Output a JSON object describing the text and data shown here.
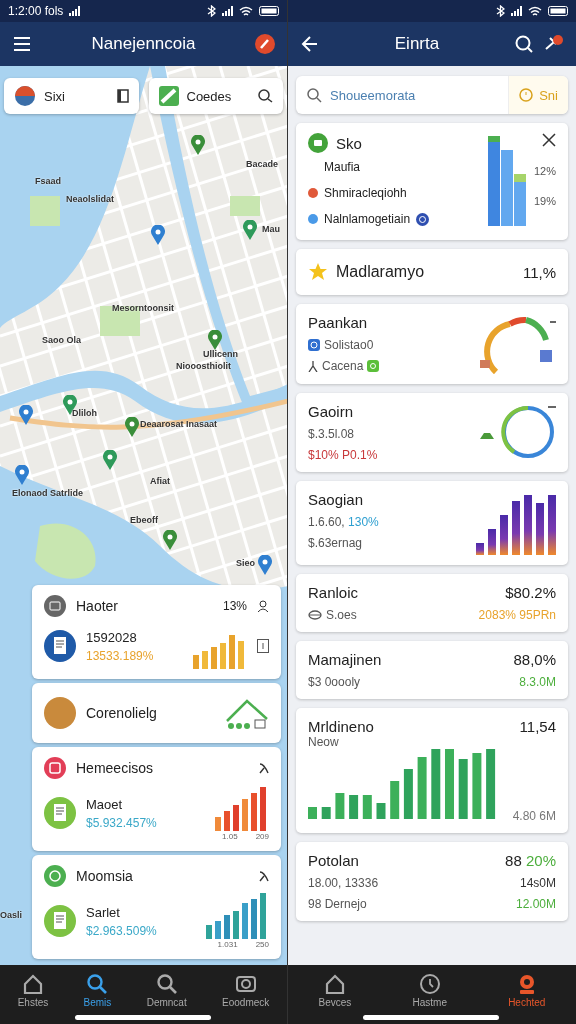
{
  "left": {
    "status": {
      "time": "1:2:00 fols"
    },
    "title": "Nanejenncoia",
    "chips": [
      {
        "label": "Sixi"
      },
      {
        "label": "Coedes"
      }
    ],
    "map_labels": [
      "Fsaad",
      "Neaolslidat",
      "Bacade",
      "Mau",
      "Mesorntoonsit",
      "Saoo Ola",
      "Ullicenn",
      "Niooosthiolit",
      "Dliloh",
      "Deaarosat Inasaat",
      "Afiat",
      "Elonaod Satrlide",
      "Ebeoff",
      "Sieo",
      "Oasli"
    ],
    "cards": [
      {
        "kind": "trend",
        "title": "Haoter",
        "value": "13%",
        "primary": "1592028",
        "secondary": "13533.189%",
        "color": "#e8a32c"
      },
      {
        "kind": "house",
        "title": "Corenolielg"
      },
      {
        "kind": "trend",
        "title": "Hemeecisos",
        "primary": "Maoet",
        "secondary": "$5.932.457%",
        "color": "#3aa8c8",
        "axis": [
          "1.05",
          "209"
        ]
      },
      {
        "kind": "trend",
        "title": "Moomsia",
        "primary": "Sarlet",
        "secondary": "$2.963.509%",
        "color": "#3aa8c8",
        "axis": [
          "1.031",
          "250"
        ]
      }
    ],
    "nav": [
      {
        "label": "Ehstes",
        "selected": false
      },
      {
        "label": "Bemis",
        "selected": true
      },
      {
        "label": "Demncat",
        "selected": false
      },
      {
        "label": "Eoodmeck",
        "selected": false
      }
    ]
  },
  "right": {
    "title": "Einrta",
    "search": {
      "placeholder": "Shoueemorata"
    },
    "button": "Sni",
    "cards": [
      {
        "kind": "legend",
        "title": "Sko",
        "rows": [
          {
            "label": "Maufia",
            "value": "12%"
          },
          {
            "label": "Shmiracleqiohh",
            "value": "19%",
            "color": "#e0593a"
          },
          {
            "label": "Nalnlamogetiain",
            "color": "#4a9ae8"
          }
        ]
      },
      {
        "kind": "stat",
        "title": "Madlaramyo",
        "value": [
          {
            "text": "11,%"
          }
        ]
      },
      {
        "kind": "gauge",
        "title": "Paankan",
        "lines": [
          [
            {
              "text": "Solistao0"
            }
          ],
          [
            {
              "text": "Cacena"
            }
          ]
        ]
      },
      {
        "kind": "ring",
        "title": "Gaoirn",
        "lines": [
          [
            {
              "text": "$.3.5l.08"
            }
          ],
          [
            {
              "text": "$10% P0.1%",
              "color": "#c8383a"
            }
          ]
        ]
      },
      {
        "kind": "bars",
        "title": "Saogian",
        "lines": [
          [
            {
              "text": "1.6.60, "
            },
            {
              "text": "130%",
              "color": "#2e9fd0"
            }
          ],
          [
            {
              "text": "$.63ernag"
            }
          ]
        ]
      },
      {
        "kind": "plain",
        "title": "Ranloic",
        "value": [
          {
            "text": "$80.2%"
          }
        ],
        "lines": [
          [
            {
              "text": "S.oes"
            }
          ]
        ],
        "side": [
          {
            "text": "2083% 95PRn",
            "color": "#e8a32c"
          }
        ]
      },
      {
        "kind": "plain",
        "title": "Mamajinen",
        "value": [
          {
            "text": "88,0%"
          }
        ],
        "lines": [
          [
            {
              "text": "$3 0oooly"
            }
          ]
        ],
        "side": [
          {
            "text": "8.3.0M",
            "color": "#4cae3c"
          }
        ]
      },
      {
        "kind": "wide-bars",
        "title": "Mrldineno",
        "value": [
          {
            "text": "11,54"
          }
        ],
        "lines": [
          [
            {
              "text": "Neow"
            }
          ]
        ],
        "side": [
          {
            "text": "4.80 6M"
          }
        ]
      },
      {
        "kind": "plain",
        "title": "Potolan",
        "value": [
          {
            "text": "88 "
          },
          {
            "text": "20%",
            "color": "#4cae3c"
          }
        ],
        "lines": [
          [
            {
              "text": "18.00, 13336"
            }
          ],
          [
            {
              "text": "98 Dernejo"
            }
          ]
        ],
        "side": [
          {
            "text": "14s0M"
          },
          {
            "text": "12.00M",
            "color": "#4cae3c"
          }
        ]
      }
    ],
    "nav": [
      {
        "label": "Bevces",
        "selected": false
      },
      {
        "label": "Hastme",
        "selected": false
      },
      {
        "label": "Hechted",
        "selected": true
      }
    ]
  }
}
